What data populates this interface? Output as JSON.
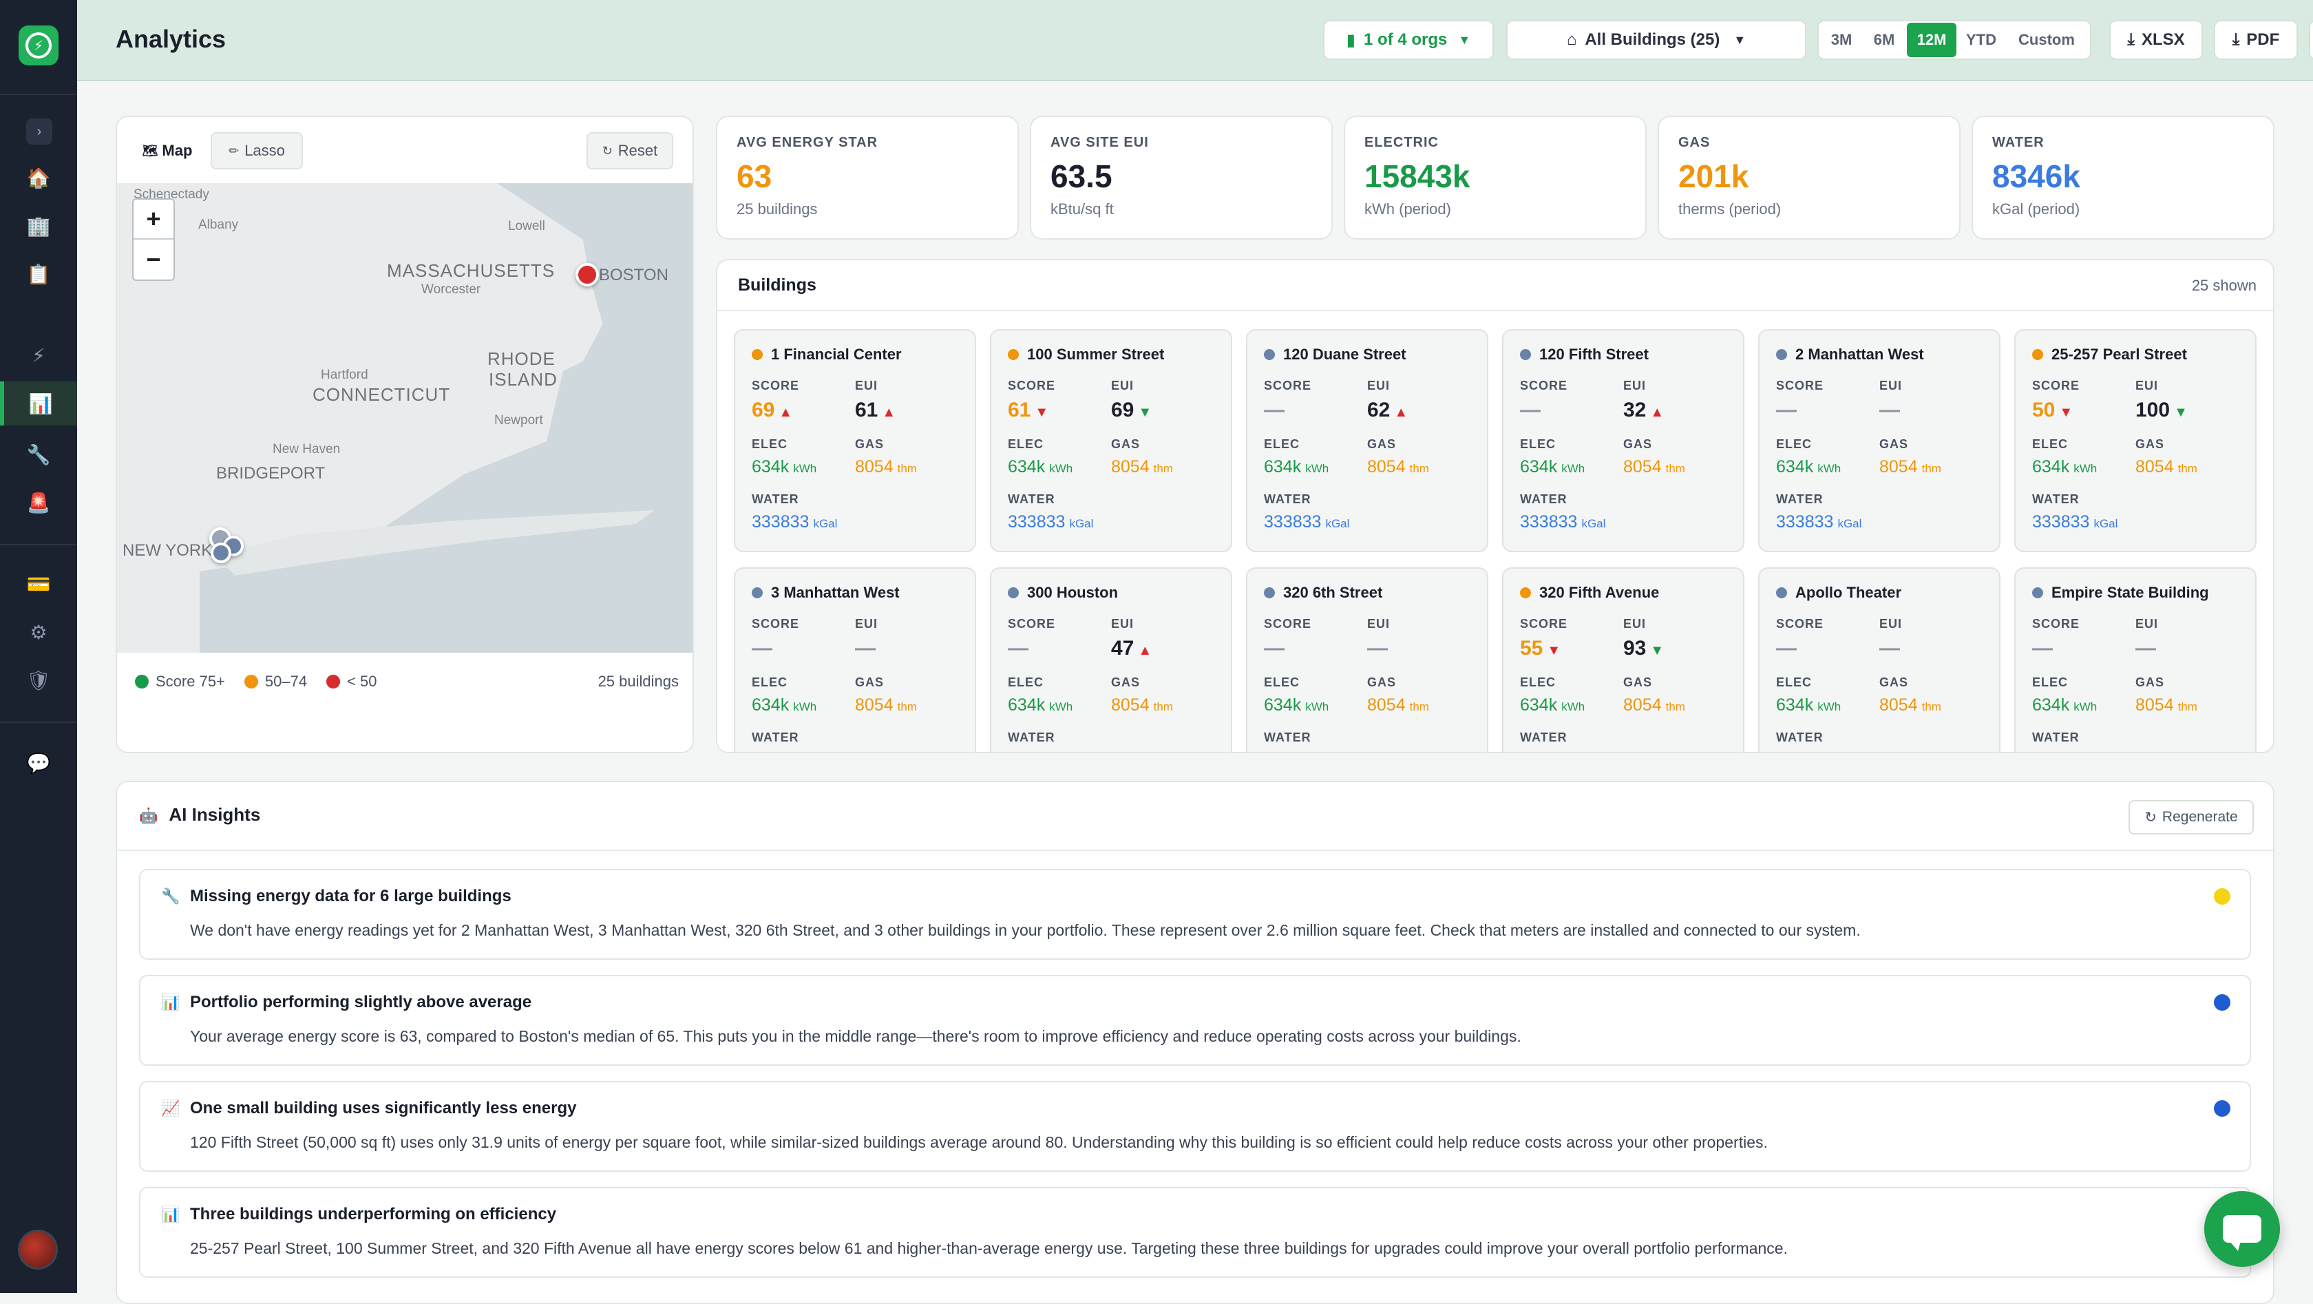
{
  "header": {
    "title": "Analytics",
    "orgs": "1 of 4 orgs",
    "buildings_filter": "All Buildings (25)",
    "periods": [
      "3M",
      "6M",
      "12M",
      "YTD",
      "Custom"
    ],
    "active_period": "12M",
    "xlsx": "XLSX",
    "pdf": "PDF"
  },
  "map": {
    "tab_map": "Map",
    "tab_lasso": "Lasso",
    "reset": "Reset",
    "zoom_in": "+",
    "zoom_out": "−",
    "labels": {
      "schenectady": "Schenectady",
      "albany": "Albany",
      "lowell": "Lowell",
      "massachusetts": "MASSACHUSETTS",
      "worcester": "Worcester",
      "boston": "BOSTON",
      "hartford": "Hartford",
      "connecticut": "CONNECTICUT",
      "rhode1": "RHODE",
      "rhode2": "ISLAND",
      "newport": "Newport",
      "newhaven": "New Haven",
      "bridgeport": "BRIDGEPORT",
      "newyork": "NEW YORK"
    },
    "legend": {
      "green": "Score 75+",
      "orange": "50–74",
      "red": "< 50",
      "count": "25 buildings"
    }
  },
  "kpis": [
    {
      "label": "AVG ENERGY STAR",
      "value": "63",
      "sub": "25 buildings",
      "color": "#f0950c"
    },
    {
      "label": "AVG SITE EUI",
      "value": "63.5",
      "sub": "kBtu/sq ft",
      "color": "#1a1f2b"
    },
    {
      "label": "ELECTRIC",
      "value": "15843k",
      "sub": "kWh (period)",
      "color": "#1a9a48"
    },
    {
      "label": "GAS",
      "value": "201k",
      "sub": "therms (period)",
      "color": "#f0950c"
    },
    {
      "label": "WATER",
      "value": "8346k",
      "sub": "kGal (period)",
      "color": "#3a7be0"
    }
  ],
  "buildings": {
    "title": "Buildings",
    "count": "25 shown",
    "labels": {
      "score": "SCORE",
      "eui": "EUI",
      "elec": "ELEC",
      "gas": "GAS",
      "water": "WATER",
      "kwh": "kWh",
      "thm": "thm",
      "kgal": "kGal"
    },
    "items": [
      {
        "name": "1 Financial Center",
        "dot": "#f0950c",
        "score": "69",
        "score_trend": "▲",
        "score_color": "#f0950c",
        "eui": "61",
        "eui_trend": "▲",
        "elec": "634k",
        "gas": "8054",
        "water": "333833"
      },
      {
        "name": "100 Summer Street",
        "dot": "#f0950c",
        "score": "61",
        "score_trend": "▼",
        "score_color": "#f0950c",
        "eui": "69",
        "eui_trend": "▼",
        "elec": "634k",
        "gas": "8054",
        "water": "333833"
      },
      {
        "name": "120 Duane Street",
        "dot": "#6b82a8",
        "score": "—",
        "score_trend": "",
        "score_color": "#8a93a2",
        "eui": "62",
        "eui_trend": "▲",
        "elec": "634k",
        "gas": "8054",
        "water": "333833"
      },
      {
        "name": "120 Fifth Street",
        "dot": "#6b82a8",
        "score": "—",
        "score_trend": "",
        "score_color": "#8a93a2",
        "eui": "32",
        "eui_trend": "▲",
        "elec": "634k",
        "gas": "8054",
        "water": "333833"
      },
      {
        "name": "2 Manhattan West",
        "dot": "#6b82a8",
        "score": "—",
        "score_trend": "",
        "score_color": "#8a93a2",
        "eui": "—",
        "eui_trend": "",
        "elec": "634k",
        "gas": "8054",
        "water": "333833"
      },
      {
        "name": "25-257 Pearl Street",
        "dot": "#f0950c",
        "score": "50",
        "score_trend": "▼",
        "score_color": "#f0950c",
        "eui": "100",
        "eui_trend": "▼",
        "elec": "634k",
        "gas": "8054",
        "water": "333833"
      },
      {
        "name": "3 Manhattan West",
        "dot": "#6b82a8",
        "score": "—",
        "score_trend": "",
        "score_color": "#8a93a2",
        "eui": "—",
        "eui_trend": "",
        "elec": "634k",
        "gas": "8054",
        "water": ""
      },
      {
        "name": "300 Houston",
        "dot": "#6b82a8",
        "score": "—",
        "score_trend": "",
        "score_color": "#8a93a2",
        "eui": "47",
        "eui_trend": "▲",
        "elec": "634k",
        "gas": "8054",
        "water": ""
      },
      {
        "name": "320 6th Street",
        "dot": "#6b82a8",
        "score": "—",
        "score_trend": "",
        "score_color": "#8a93a2",
        "eui": "—",
        "eui_trend": "",
        "elec": "634k",
        "gas": "8054",
        "water": ""
      },
      {
        "name": "320 Fifth Avenue",
        "dot": "#f0950c",
        "score": "55",
        "score_trend": "▼",
        "score_color": "#f0950c",
        "eui": "93",
        "eui_trend": "▼",
        "elec": "634k",
        "gas": "8054",
        "water": ""
      },
      {
        "name": "Apollo Theater",
        "dot": "#6b82a8",
        "score": "—",
        "score_trend": "",
        "score_color": "#8a93a2",
        "eui": "—",
        "eui_trend": "",
        "elec": "634k",
        "gas": "8054",
        "water": ""
      },
      {
        "name": "Empire State Building",
        "dot": "#6b82a8",
        "score": "—",
        "score_trend": "",
        "score_color": "#8a93a2",
        "eui": "—",
        "eui_trend": "",
        "elec": "634k",
        "gas": "8054",
        "water": ""
      }
    ]
  },
  "insights": {
    "title": "AI Insights",
    "regenerate": "Regenerate",
    "items": [
      {
        "icon": "wrench-icon",
        "glyph": "🔧",
        "title": "Missing energy data for 6 large buildings",
        "body": "We don't have energy readings yet for 2 Manhattan West, 3 Manhattan West, 320 6th Street, and 3 other buildings in your portfolio. These represent over 2.6 million square feet. Check that meters are installed and connected to our system.",
        "dot": "#f5d312"
      },
      {
        "icon": "bar-chart-icon",
        "glyph": "📊",
        "title": "Portfolio performing slightly above average",
        "body": "Your average energy score is 63, compared to Boston's median of 65. This puts you in the middle range—there's room to improve efficiency and reduce operating costs across your buildings.",
        "dot": "#1f5bd1"
      },
      {
        "icon": "trend-chart-icon",
        "glyph": "📈",
        "title": "One small building uses significantly less energy",
        "body": "120 Fifth Street (50,000 sq ft) uses only 31.9 units of energy per square foot, while similar-sized buildings average around 80. Understanding why this building is so efficient could help reduce costs across your other properties.",
        "dot": "#1f5bd1"
      },
      {
        "icon": "bar-chart-icon",
        "glyph": "📊",
        "title": "Three buildings underperforming on efficiency",
        "body": "25-257 Pearl Street, 100 Summer Street, and 320 Fifth Avenue all have energy scores below 61 and higher-than-average energy use. Targeting these three buildings for upgrades could improve your overall portfolio performance.",
        "dot": ""
      }
    ]
  }
}
